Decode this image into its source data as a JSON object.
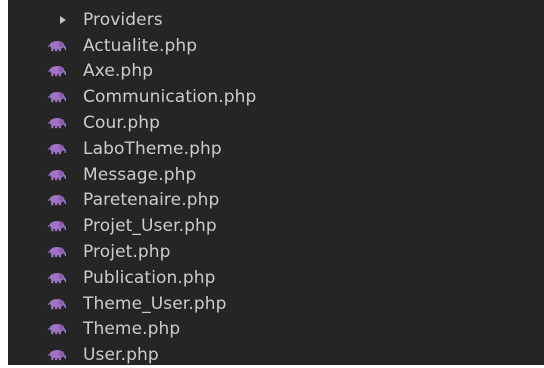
{
  "explorer": {
    "folder": {
      "label": "Providers",
      "icon": "chevron-right-icon",
      "expanded": false
    },
    "files": [
      {
        "label": "Actualite.php",
        "icon": "php-elephant-icon"
      },
      {
        "label": "Axe.php",
        "icon": "php-elephant-icon"
      },
      {
        "label": "Communication.php",
        "icon": "php-elephant-icon"
      },
      {
        "label": "Cour.php",
        "icon": "php-elephant-icon"
      },
      {
        "label": "LaboTheme.php",
        "icon": "php-elephant-icon"
      },
      {
        "label": "Message.php",
        "icon": "php-elephant-icon"
      },
      {
        "label": "Paretenaire.php",
        "icon": "php-elephant-icon"
      },
      {
        "label": "Projet_User.php",
        "icon": "php-elephant-icon"
      },
      {
        "label": "Projet.php",
        "icon": "php-elephant-icon"
      },
      {
        "label": "Publication.php",
        "icon": "php-elephant-icon"
      },
      {
        "label": "Theme_User.php",
        "icon": "php-elephant-icon"
      },
      {
        "label": "Theme.php",
        "icon": "php-elephant-icon"
      },
      {
        "label": "User.php",
        "icon": "php-elephant-icon"
      }
    ]
  },
  "colors": {
    "background": "#252526",
    "text": "#cccccc",
    "php_icon": "#a074c4"
  }
}
